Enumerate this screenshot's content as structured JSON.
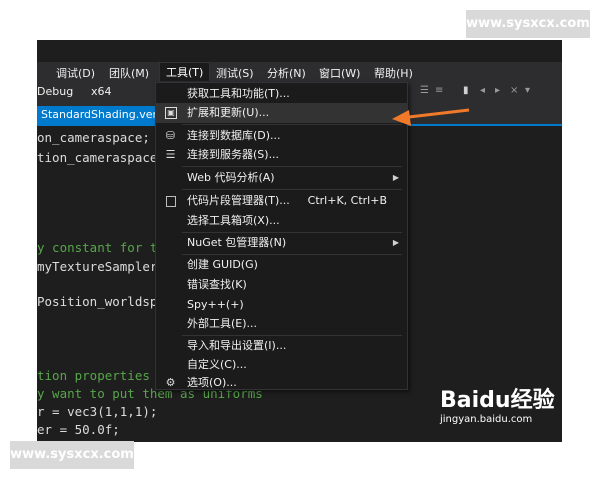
{
  "menubar": {
    "items": [
      "调试(D)",
      "团队(M)",
      "工具(T)",
      "测试(S)",
      "分析(N)",
      "窗口(W)",
      "帮助(H)"
    ],
    "active": "工具(T)"
  },
  "toolbar": {
    "config": "Debug",
    "platform": "x64"
  },
  "tab": {
    "title": "StandardShading.verte"
  },
  "code_lines": [
    "on_cameraspace;",
    "tion_cameraspace",
    "y constant for t",
    "myTextureSampler",
    "Position_worldsp",
    "tion properties",
    "y want to put them as uniforms",
    "r = vec3(1,1,1);",
    "er = 50.0f;"
  ],
  "menu": {
    "items": [
      {
        "label": "获取工具和功能(T)...",
        "icon": "",
        "shortcut": "",
        "submenu": false
      },
      {
        "label": "扩展和更新(U)...",
        "icon": "extensions-icon",
        "shortcut": "",
        "submenu": false
      },
      {
        "label": "连接到数据库(D)...",
        "icon": "database-connect-icon",
        "shortcut": "",
        "submenu": false
      },
      {
        "label": "连接到服务器(S)...",
        "icon": "server-connect-icon",
        "shortcut": "",
        "submenu": false
      },
      {
        "label": "Web 代码分析(A)",
        "icon": "",
        "shortcut": "",
        "submenu": true
      },
      {
        "label": "代码片段管理器(T)...",
        "icon": "checkbox-icon",
        "shortcut": "Ctrl+K, Ctrl+B",
        "submenu": false
      },
      {
        "label": "选择工具箱项(X)...",
        "icon": "",
        "shortcut": "",
        "submenu": false
      },
      {
        "label": "NuGet 包管理器(N)",
        "icon": "",
        "shortcut": "",
        "submenu": true
      },
      {
        "label": "创建 GUID(G)",
        "icon": "",
        "shortcut": "",
        "submenu": false
      },
      {
        "label": "错误查找(K)",
        "icon": "",
        "shortcut": "",
        "submenu": false
      },
      {
        "label": "Spy++(+)",
        "icon": "",
        "shortcut": "",
        "submenu": false
      },
      {
        "label": "外部工具(E)...",
        "icon": "",
        "shortcut": "",
        "submenu": false
      },
      {
        "label": "导入和导出设置(I)...",
        "icon": "",
        "shortcut": "",
        "submenu": false
      },
      {
        "label": "自定义(C)...",
        "icon": "",
        "shortcut": "",
        "submenu": false
      },
      {
        "label": "选项(O)...",
        "icon": "gear-icon",
        "shortcut": "",
        "submenu": false
      }
    ]
  },
  "watermarks": {
    "top": "www.sysxcx.com",
    "bottom": "www.sysxcx.com",
    "baidu_logo": "Baidu经验",
    "baidu_url": "jingyan.baidu.com"
  },
  "colors": {
    "accent": "#007acc",
    "annotation_arrow": "#f07a2a",
    "menu_bg": "#1b1b1c",
    "editor_bg": "#1e1e1e",
    "comment": "#57a64a"
  }
}
